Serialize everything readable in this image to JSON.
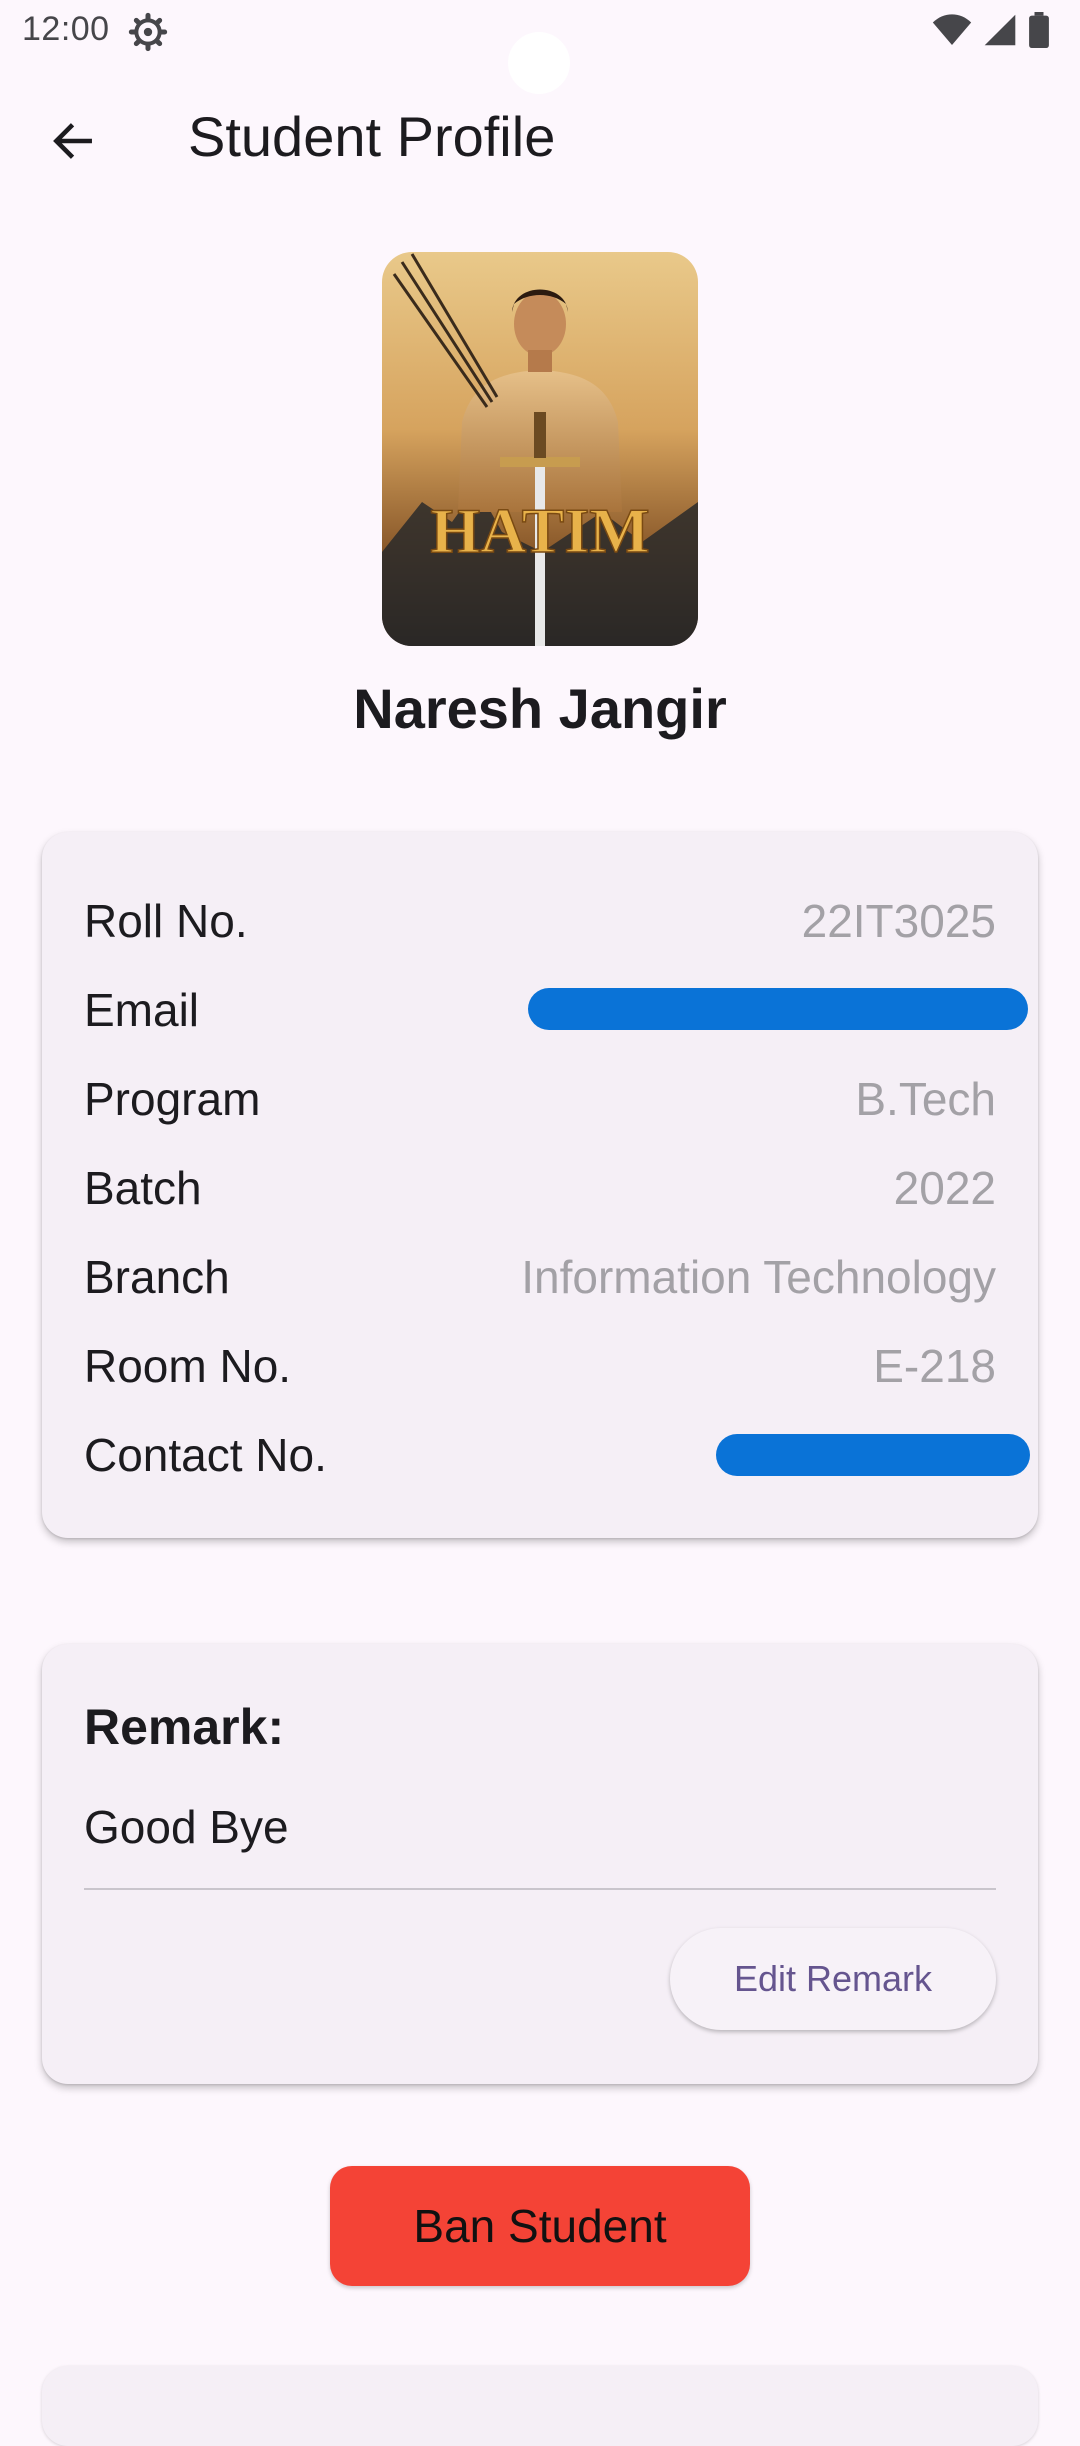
{
  "status_bar": {
    "time": "12:00",
    "icons": [
      "settings-gear-icon",
      "wifi-icon",
      "signal-icon",
      "battery-icon"
    ]
  },
  "app_bar": {
    "title": "Student Profile",
    "back_icon": "arrow-left-icon"
  },
  "profile": {
    "name": "Naresh Jangir",
    "photo_caption": "HATIM"
  },
  "info": {
    "rows": [
      {
        "label": "Roll No.",
        "value": "22IT3025"
      },
      {
        "label": "Email",
        "value": ""
      },
      {
        "label": "Program",
        "value": "B.Tech"
      },
      {
        "label": "Batch",
        "value": "2022"
      },
      {
        "label": "Branch",
        "value": "Information Technology"
      },
      {
        "label": "Room No.",
        "value": "E-218"
      },
      {
        "label": "Contact No.",
        "value": ""
      }
    ]
  },
  "remark": {
    "title": "Remark:",
    "text": "Good Bye",
    "edit_label": "Edit Remark"
  },
  "actions": {
    "ban_label": "Ban Student"
  },
  "colors": {
    "background": "#FDF7FD",
    "card": "#F5EFF6",
    "ban_button": "#F44336",
    "edit_text": "#65558F",
    "redaction": "#0A73D7"
  }
}
